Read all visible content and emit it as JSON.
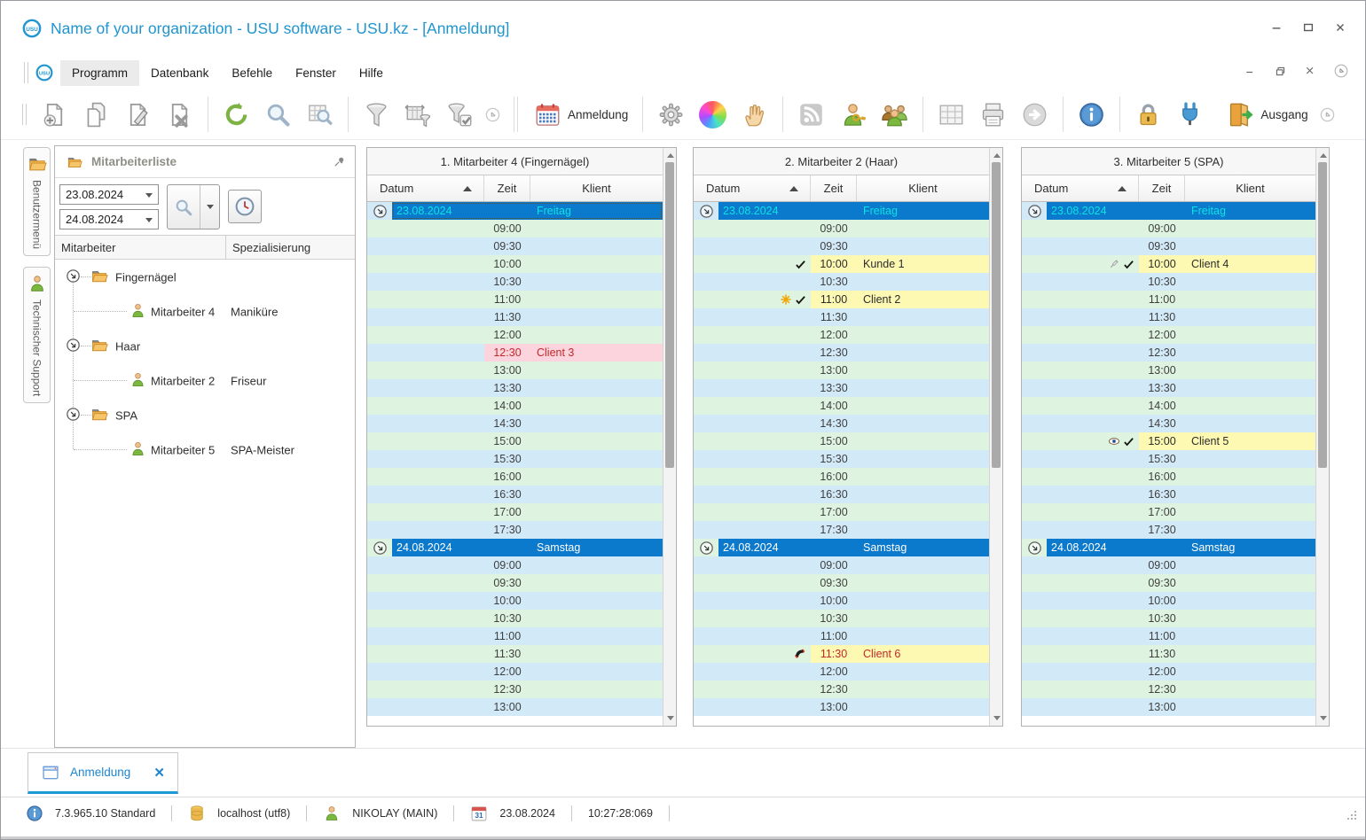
{
  "window": {
    "title": "Name of your organization - USU software - USU.kz - [Anmeldung]"
  },
  "menu": {
    "items": [
      "Programm",
      "Datenbank",
      "Befehle",
      "Fenster",
      "Hilfe"
    ],
    "active_index": 0
  },
  "toolbar": {
    "groups": [
      {
        "items": [
          {
            "icon": "new-document"
          },
          {
            "icon": "copy-document"
          },
          {
            "icon": "edit-document"
          },
          {
            "icon": "delete-document"
          }
        ]
      },
      {
        "items": [
          {
            "icon": "refresh"
          },
          {
            "icon": "search"
          },
          {
            "icon": "table-search"
          }
        ]
      },
      {
        "items": [
          {
            "icon": "filter"
          },
          {
            "icon": "filter-columns"
          },
          {
            "icon": "filter-apply"
          },
          {
            "icon": "chevron-down-circle",
            "small": true
          }
        ],
        "double_sep_after": true
      },
      {
        "items": [
          {
            "icon": "calendar",
            "label": "Anmeldung"
          }
        ]
      },
      {
        "items": [
          {
            "icon": "settings-gear"
          },
          {
            "icon": "color-wheel"
          },
          {
            "icon": "hand"
          }
        ]
      },
      {
        "items": [
          {
            "icon": "rss"
          },
          {
            "icon": "user-key"
          },
          {
            "icon": "users-group"
          }
        ]
      },
      {
        "items": [
          {
            "icon": "table-grid"
          },
          {
            "icon": "printer"
          },
          {
            "icon": "forward-arrow"
          }
        ]
      },
      {
        "items": [
          {
            "icon": "info"
          }
        ]
      },
      {
        "items": [
          {
            "icon": "lock"
          },
          {
            "icon": "plug"
          }
        ],
        "no_sep_after": true
      },
      {
        "items": [
          {
            "icon": "exit-door",
            "label": "Ausgang"
          },
          {
            "icon": "chevron-down-circle",
            "small": true
          }
        ]
      }
    ]
  },
  "sidebar_tabs": [
    {
      "icon": "folder",
      "label": "Benutzermenü"
    },
    {
      "icon": "person",
      "label": "Technischer Support"
    }
  ],
  "employee_panel": {
    "title": "Mitarbeiterliste",
    "date_from": "23.08.2024",
    "date_to": "24.08.2024",
    "columns": [
      "Mitarbeiter",
      "Spezialisierung"
    ],
    "groups": [
      {
        "label": "Fingernägel",
        "children": [
          {
            "name": "Mitarbeiter 4",
            "specialization": "Maniküre"
          }
        ]
      },
      {
        "label": "Haar",
        "children": [
          {
            "name": "Mitarbeiter 2",
            "specialization": "Friseur"
          }
        ]
      },
      {
        "label": "SPA",
        "children": [
          {
            "name": "Mitarbeiter 5",
            "specialization": "SPA-Meister"
          }
        ]
      }
    ]
  },
  "schedule": {
    "headers": [
      "Datum",
      "Zeit",
      "Klient"
    ],
    "days": [
      {
        "date": "23.08.2024",
        "weekday": "Freitag",
        "highlight": "cyan",
        "times": [
          "09:00",
          "09:30",
          "10:00",
          "10:30",
          "11:00",
          "11:30",
          "12:00",
          "12:30",
          "13:00",
          "13:30",
          "14:00",
          "14:30",
          "15:00",
          "15:30",
          "16:00",
          "16:30",
          "17:00",
          "17:30"
        ]
      },
      {
        "date": "24.08.2024",
        "weekday": "Samstag",
        "highlight": "white",
        "times": [
          "09:00",
          "09:30",
          "10:00",
          "10:30",
          "11:00",
          "11:30",
          "12:00",
          "12:30",
          "13:00"
        ]
      }
    ],
    "columns": [
      {
        "title": "1. Mitarbeiter 4 (Fingernägel)",
        "appointments": [
          {
            "day": 0,
            "time": "12:30",
            "client": "Client 3",
            "style": "pink",
            "icons": []
          }
        ]
      },
      {
        "title": "2. Mitarbeiter 2 (Haar)",
        "appointments": [
          {
            "day": 0,
            "time": "10:00",
            "client": "Kunde 1",
            "style": "yellow",
            "icons": [
              "check"
            ]
          },
          {
            "day": 0,
            "time": "11:00",
            "client": "Client 2",
            "style": "yellow",
            "icons": [
              "asterisk",
              "check"
            ]
          },
          {
            "day": 1,
            "time": "11:30",
            "client": "Client 6",
            "style": "yellow-red",
            "icons": [
              "phone"
            ]
          }
        ]
      },
      {
        "title": "3. Mitarbeiter 5 (SPA)",
        "appointments": [
          {
            "day": 0,
            "time": "10:00",
            "client": "Client 4",
            "style": "yellow",
            "icons": [
              "syringe",
              "check"
            ]
          },
          {
            "day": 0,
            "time": "15:00",
            "client": "Client 5",
            "style": "yellow",
            "icons": [
              "eye",
              "check"
            ]
          }
        ]
      }
    ]
  },
  "bottom_tabs": [
    {
      "icon": "window",
      "label": "Anmeldung",
      "active": true
    }
  ],
  "status_bar": {
    "items": [
      {
        "icon": "info",
        "text": "7.3.965.10 Standard"
      },
      {
        "icon": "database",
        "text": "localhost (utf8)"
      },
      {
        "icon": "user",
        "text": "NIKOLAY (MAIN)"
      },
      {
        "icon": "calendar-31",
        "text": "23.08.2024"
      },
      {
        "icon": "",
        "text": "10:27:28:069"
      }
    ]
  },
  "colors": {
    "accent_blue": "#1d9ad6",
    "selected_row_blue": "#0b79cc",
    "friday_text_cyan": "#0de2e2",
    "saturday_text_white": "#ffffff",
    "zebra_green": "#dff4e0",
    "zebra_blue": "#d2e9f7",
    "appointment_yellow": "#fdf8b2",
    "appointment_pink": "#fbd4dd",
    "alert_red": "#c22a2a"
  }
}
